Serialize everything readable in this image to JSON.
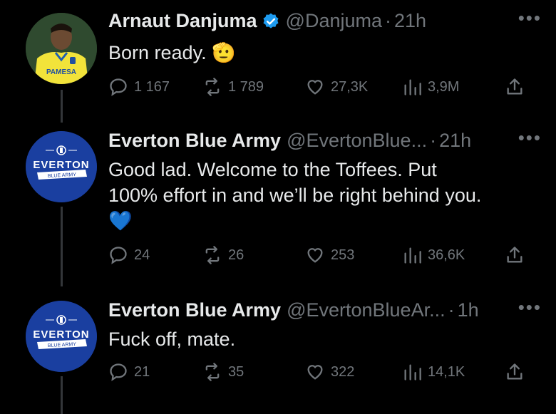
{
  "tweets": [
    {
      "name": "Arnaut Danjuma",
      "handle": "@Danjuma",
      "time": "21h",
      "text": "Born ready. 🫡",
      "replies": "1 167",
      "retweets": "1 789",
      "likes": "27,3K",
      "views": "3,9M",
      "verified": true
    },
    {
      "name": "Everton Blue Army",
      "handle": "@EvertonBlue...",
      "time": "21h",
      "text_line1": "Good lad. Welcome to the Toffees. Put",
      "text_line2": "100% effort in and we’ll be right behind you.",
      "emoji": "💙",
      "replies": "24",
      "retweets": "26",
      "likes": "253",
      "views": "36,6K"
    },
    {
      "name": "Everton Blue Army",
      "handle": "@EvertonBlueAr...",
      "time": "1h",
      "text": "Fuck off, mate.",
      "replies": "21",
      "retweets": "35",
      "likes": "322",
      "views": "14,1K"
    }
  ],
  "ui": {
    "more": "•••",
    "separator": "·",
    "avatar2_word": "EVERTON",
    "avatar2_banner": "BLUE ARMY",
    "avatar1_sponsor": "PAMESA"
  },
  "colors": {
    "background": "#000000",
    "text": "#e7e9ea",
    "secondary": "#71767b",
    "verified": "#1d9bf0",
    "everton_blue": "#1a3fa0"
  },
  "icons": [
    "reply-icon",
    "retweet-icon",
    "like-icon",
    "views-icon",
    "share-icon",
    "verified-badge-icon",
    "more-icon"
  ]
}
